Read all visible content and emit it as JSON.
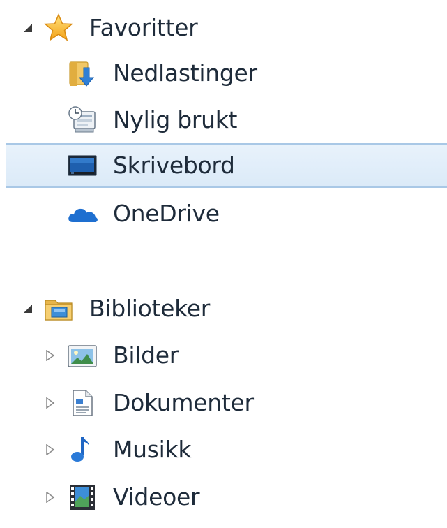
{
  "favorites": {
    "label": "Favoritter",
    "icon": "star-icon",
    "expanded": true,
    "items": [
      {
        "label": "Nedlastinger",
        "icon": "downloads-folder-icon"
      },
      {
        "label": "Nylig brukt",
        "icon": "recent-places-icon"
      },
      {
        "label": "Skrivebord",
        "icon": "desktop-icon",
        "selected": true
      },
      {
        "label": "OneDrive",
        "icon": "onedrive-cloud-icon"
      }
    ]
  },
  "libraries": {
    "label": "Biblioteker",
    "icon": "libraries-folder-icon",
    "expanded": true,
    "items": [
      {
        "label": "Bilder",
        "icon": "pictures-icon"
      },
      {
        "label": "Dokumenter",
        "icon": "documents-icon"
      },
      {
        "label": "Musikk",
        "icon": "music-note-icon"
      },
      {
        "label": "Videoer",
        "icon": "videos-film-icon"
      }
    ]
  },
  "colors": {
    "selection_background": "#dbeaf8",
    "selection_border": "#a9c8e6",
    "text": "#1e2b3a"
  }
}
